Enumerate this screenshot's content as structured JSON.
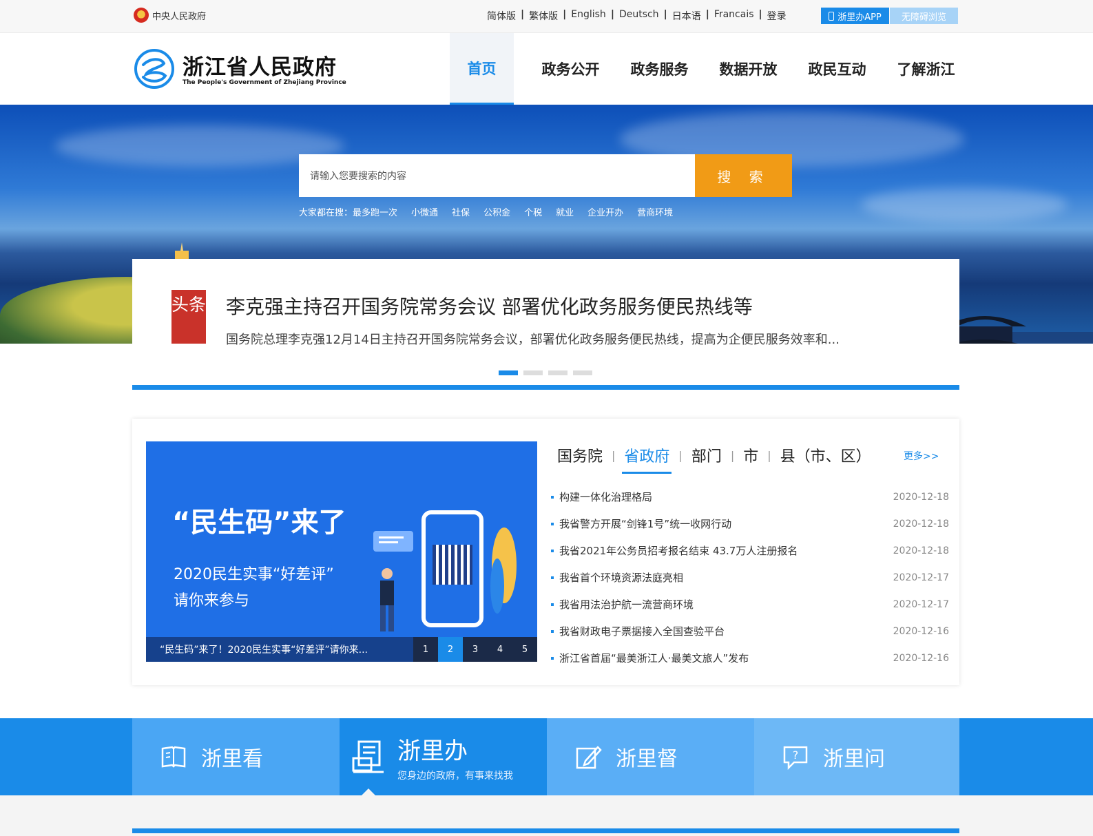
{
  "topbar": {
    "gov_link": "中央人民政府",
    "languages": [
      "简体版",
      "繁体版",
      "English",
      "Deutsch",
      "日本语",
      "Francais",
      "登录"
    ],
    "app_button": "浙里办APP",
    "accessibility_button": "无障碍浏览"
  },
  "header": {
    "site_title": "浙江省人民政府",
    "site_subtitle": "The People's Government of Zhejiang Province",
    "nav": [
      "首页",
      "政务公开",
      "政务服务",
      "数据开放",
      "政民互动",
      "了解浙江"
    ],
    "nav_active": "首页"
  },
  "search": {
    "placeholder": "请输入您要搜索的内容",
    "button": "搜 索",
    "hot_label": "大家都在搜：",
    "hot_terms": [
      "最多跑一次",
      "小微通",
      "社保",
      "公积金",
      "个税",
      "就业",
      "企业开办",
      "营商环境"
    ]
  },
  "headline": {
    "tag": "头条",
    "title": "李克强主持召开国务院常务会议 部署优化政务服务便民热线等",
    "desc": "国务院总理李克强12月14日主持召开国务院常务会议，部署优化政务服务便民热线，提高为企便民服务效率和..."
  },
  "promo": {
    "title": "“民生码”来了",
    "line1": "2020民生实事“好差评”",
    "line2": "请你来参与",
    "caption": "“民生码”来了！2020民生实事“好差评”请你来...",
    "pages": [
      "1",
      "2",
      "3",
      "4",
      "5"
    ],
    "active_page": "2"
  },
  "news": {
    "tabs": [
      "国务院",
      "省政府",
      "部门",
      "市",
      "县（市、区）"
    ],
    "active_tab": "省政府",
    "more": "更多>>",
    "items": [
      {
        "title": "构建一体化治理格局",
        "date": "2020-12-18"
      },
      {
        "title": "我省警方开展“剑锋1号”统一收网行动",
        "date": "2020-12-18"
      },
      {
        "title": "我省2021年公务员招考报名结束 43.7万人注册报名",
        "date": "2020-12-18"
      },
      {
        "title": "我省首个环境资源法庭亮相",
        "date": "2020-12-17"
      },
      {
        "title": "我省用法治护航一流营商环境",
        "date": "2020-12-17"
      },
      {
        "title": "我省财政电子票据接入全国查验平台",
        "date": "2020-12-16"
      },
      {
        "title": "浙江省首届“最美浙江人·最美文旅人”发布",
        "date": "2020-12-16"
      }
    ]
  },
  "services": [
    {
      "name": "浙里看",
      "sub": "",
      "icon": "book-icon",
      "color": "#4aa6f4"
    },
    {
      "name": "浙里办",
      "sub": "您身边的政府，有事来找我",
      "icon": "service-desk-icon",
      "color": "#1a8be8"
    },
    {
      "name": "浙里督",
      "sub": "",
      "icon": "edit-icon",
      "color": "#5aaef6"
    },
    {
      "name": "浙里问",
      "sub": "",
      "icon": "question-icon",
      "color": "#6db8f6"
    }
  ]
}
